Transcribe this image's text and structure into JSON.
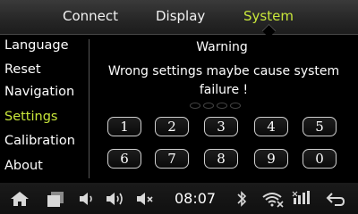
{
  "tabs": {
    "connect": "Connect",
    "display": "Display",
    "system": "System"
  },
  "sidebar": {
    "items": [
      "Language",
      "Reset",
      "Navigation",
      "Settings",
      "Calibration",
      "About"
    ]
  },
  "main": {
    "title": "Warning",
    "message": "Wrong settings maybe cause system failure !"
  },
  "keypad": {
    "row1": [
      "1",
      "2",
      "3",
      "4",
      "5"
    ],
    "row2": [
      "6",
      "7",
      "8",
      "9",
      "0"
    ]
  },
  "statusbar": {
    "time": "08:07",
    "icons": [
      "home-icon",
      "recent-apps-icon",
      "volume-down-icon",
      "volume-up-icon",
      "mute-icon",
      "bluetooth-icon",
      "wifi-off-icon",
      "signal-off-icon",
      "back-icon"
    ]
  },
  "colors": {
    "accent": "#c8e63a",
    "background": "#000000"
  }
}
